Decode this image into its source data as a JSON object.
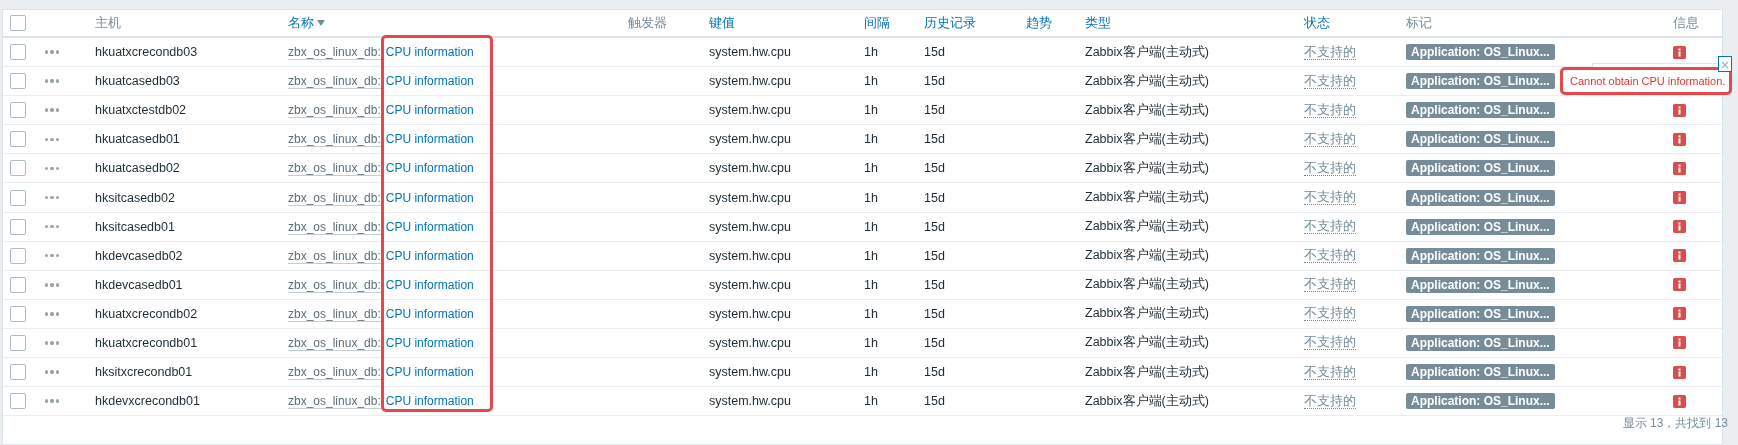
{
  "columns": [
    {
      "kind": "checkbox",
      "checked": false
    },
    {
      "kind": "blank"
    },
    {
      "label": "主机",
      "kind": "text",
      "sortable": false,
      "sorted": false
    },
    {
      "label": "名称",
      "kind": "text",
      "sortable": true,
      "sorted": true
    },
    {
      "label": "触发器",
      "kind": "text",
      "sortable": false,
      "sorted": false
    },
    {
      "label": "键值",
      "kind": "text",
      "sortable": true,
      "sorted": false
    },
    {
      "label": "间隔",
      "kind": "text",
      "sortable": true,
      "sorted": false
    },
    {
      "label": "历史记录",
      "kind": "text",
      "sortable": true,
      "sorted": false
    },
    {
      "label": "趋势",
      "kind": "text",
      "sortable": true,
      "sorted": false
    },
    {
      "label": "类型",
      "kind": "text",
      "sortable": true,
      "sorted": false
    },
    {
      "label": "状态",
      "kind": "text",
      "sortable": true,
      "sorted": false
    },
    {
      "label": "标记",
      "kind": "text",
      "sortable": false,
      "sorted": false
    },
    {
      "label": "信息",
      "kind": "text",
      "sortable": false,
      "sorted": false
    }
  ],
  "rows": [
    {
      "checked": false,
      "host": "hkuatxcrecondb03",
      "prefix": "zbx_os_linux_db:",
      "name": "CPU information",
      "key": "system.hw.cpu",
      "interval": "1h",
      "history": "15d",
      "type": "Zabbix客户端(主动式)",
      "status": "不支持的",
      "tag": "Application: OS_Linux...",
      "info": true
    },
    {
      "checked": false,
      "host": "hkuatcasedb03",
      "prefix": "zbx_os_linux_db:",
      "name": "CPU information",
      "key": "system.hw.cpu",
      "interval": "1h",
      "history": "15d",
      "type": "Zabbix客户端(主动式)",
      "status": "不支持的",
      "tag": "Application: OS_Linux...",
      "info": false
    },
    {
      "checked": false,
      "host": "hkuatxctestdb02",
      "prefix": "zbx_os_linux_db:",
      "name": "CPU information",
      "key": "system.hw.cpu",
      "interval": "1h",
      "history": "15d",
      "type": "Zabbix客户端(主动式)",
      "status": "不支持的",
      "tag": "Application: OS_Linux...",
      "info": true
    },
    {
      "checked": false,
      "host": "hkuatcasedb01",
      "prefix": "zbx_os_linux_db:",
      "name": "CPU information",
      "key": "system.hw.cpu",
      "interval": "1h",
      "history": "15d",
      "type": "Zabbix客户端(主动式)",
      "status": "不支持的",
      "tag": "Application: OS_Linux...",
      "info": true
    },
    {
      "checked": false,
      "host": "hkuatcasedb02",
      "prefix": "zbx_os_linux_db:",
      "name": "CPU information",
      "key": "system.hw.cpu",
      "interval": "1h",
      "history": "15d",
      "type": "Zabbix客户端(主动式)",
      "status": "不支持的",
      "tag": "Application: OS_Linux...",
      "info": true
    },
    {
      "checked": false,
      "host": "hksitcasedb02",
      "prefix": "zbx_os_linux_db:",
      "name": "CPU information",
      "key": "system.hw.cpu",
      "interval": "1h",
      "history": "15d",
      "type": "Zabbix客户端(主动式)",
      "status": "不支持的",
      "tag": "Application: OS_Linux...",
      "info": true
    },
    {
      "checked": false,
      "host": "hksitcasedb01",
      "prefix": "zbx_os_linux_db:",
      "name": "CPU information",
      "key": "system.hw.cpu",
      "interval": "1h",
      "history": "15d",
      "type": "Zabbix客户端(主动式)",
      "status": "不支持的",
      "tag": "Application: OS_Linux...",
      "info": true
    },
    {
      "checked": false,
      "host": "hkdevcasedb02",
      "prefix": "zbx_os_linux_db:",
      "name": "CPU information",
      "key": "system.hw.cpu",
      "interval": "1h",
      "history": "15d",
      "type": "Zabbix客户端(主动式)",
      "status": "不支持的",
      "tag": "Application: OS_Linux...",
      "info": true
    },
    {
      "checked": false,
      "host": "hkdevcasedb01",
      "prefix": "zbx_os_linux_db:",
      "name": "CPU information",
      "key": "system.hw.cpu",
      "interval": "1h",
      "history": "15d",
      "type": "Zabbix客户端(主动式)",
      "status": "不支持的",
      "tag": "Application: OS_Linux...",
      "info": true
    },
    {
      "checked": false,
      "host": "hkuatxcrecondb02",
      "prefix": "zbx_os_linux_db:",
      "name": "CPU information",
      "key": "system.hw.cpu",
      "interval": "1h",
      "history": "15d",
      "type": "Zabbix客户端(主动式)",
      "status": "不支持的",
      "tag": "Application: OS_Linux...",
      "info": true
    },
    {
      "checked": false,
      "host": "hkuatxcrecondb01",
      "prefix": "zbx_os_linux_db:",
      "name": "CPU information",
      "key": "system.hw.cpu",
      "interval": "1h",
      "history": "15d",
      "type": "Zabbix客户端(主动式)",
      "status": "不支持的",
      "tag": "Application: OS_Linux...",
      "info": true
    },
    {
      "checked": false,
      "host": "hksitxcrecondb01",
      "prefix": "zbx_os_linux_db:",
      "name": "CPU information",
      "key": "system.hw.cpu",
      "interval": "1h",
      "history": "15d",
      "type": "Zabbix客户端(主动式)",
      "status": "不支持的",
      "tag": "Application: OS_Linux...",
      "info": true
    },
    {
      "checked": false,
      "host": "hkdevxcrecondb01",
      "prefix": "zbx_os_linux_db:",
      "name": "CPU information",
      "key": "system.hw.cpu",
      "interval": "1h",
      "history": "15d",
      "type": "Zabbix客户端(主动式)",
      "status": "不支持的",
      "tag": "Application: OS_Linux...",
      "info": true
    }
  ],
  "footer": "显示 13，共找到 13",
  "tooltip": {
    "text": "Cannot obtain CPU information."
  },
  "highlight": {
    "visible": true
  }
}
